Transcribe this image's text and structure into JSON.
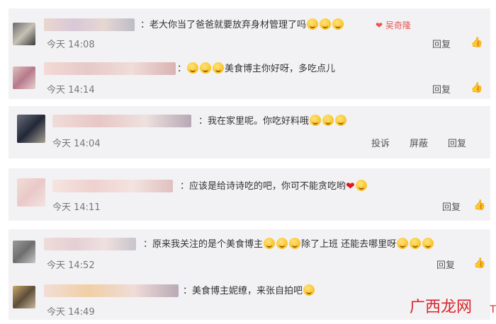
{
  "comments": [
    {
      "text": "：老大你当了爸爸就要放弃身材管理了吗",
      "emojis": 3,
      "time": "今天 14:08",
      "reply": "回复",
      "badge": "吴奇隆"
    },
    {
      "pre_emojis": 3,
      "text": "美食博主你好呀，多吃点儿",
      "time": "今天 14:14",
      "reply": "回复"
    },
    {
      "text": "：我在家里呢。你吃好料哦",
      "emojis": 3,
      "time": "今天 14:04",
      "report": "投诉",
      "block": "屏蔽",
      "reply": "回复"
    },
    {
      "text": "应该是给诗诗吃的吧，你可不能贪吃哟",
      "time": "今天 14:11",
      "reply": "回复"
    },
    {
      "text": "：原来我关注的是个美食博主",
      "mid": "除了上班  还能去哪里呀",
      "time": "今天 14:52",
      "reply": "回复"
    },
    {
      "text": "：美食博主妮缭，来张自拍吧",
      "time": "今天 14:49",
      "reply": "回复"
    }
  ],
  "watermark": "广西龙网",
  "watermark_sub": "T"
}
